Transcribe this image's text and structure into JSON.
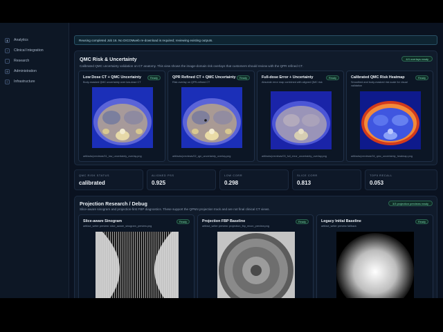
{
  "sidebar": {
    "items": [
      {
        "label": "Analytics",
        "icon": "chart-icon"
      },
      {
        "label": "Clinical Integration",
        "icon": "hospital-icon"
      },
      {
        "label": "Research",
        "icon": "flask-icon"
      },
      {
        "label": "Administration",
        "icon": "gear-icon"
      },
      {
        "label": "Infrastructure",
        "icon": "server-icon"
      }
    ]
  },
  "notice": {
    "text": "Reusing completed Job 16. No DICOMweb re-download is required; reviewing existing outputs."
  },
  "qmc": {
    "title": "QMC Risk & Uncertainty",
    "subtitle": "Calibrated QMC uncertainty validation on CT anatomy. This view shows the image-domain risk overlays that customers should review with the QPR refined CT.",
    "badge": "4/4 overlays ready",
    "cards": [
      {
        "title": "Low Dose CT + QMC Uncertainty",
        "status": "Ready",
        "desc": "Body-masked QMC uncertainty over low-dose CT",
        "path": "artifacts/previews/01_low_uncertainty_overlay.png"
      },
      {
        "title": "QPR Refined CT + QMC Uncertainty",
        "status": "Ready",
        "desc": "Risk overlay on QPR-refined CT",
        "path": "artifacts/previews/02_qpr_uncertainty_overlay.png"
      },
      {
        "title": "Full-dose Error + Uncertainty",
        "status": "Ready",
        "desc": "Absolute error map combined with aligned QMC risk",
        "path": "artifacts/previews/03_full_error_uncertainty_overlay.png"
      },
      {
        "title": "Calibrated QMC Risk Heatmap",
        "status": "Ready",
        "desc": "Smoothed and body-masked risk scale for visual validation",
        "path": "artifacts/previews/04_qmc_uncertainty_heatmap.png"
      }
    ]
  },
  "metrics": [
    {
      "label": "QMC RISK STATUS",
      "value": "calibrated"
    },
    {
      "label": "ALIGNED PSS",
      "value": "0.925"
    },
    {
      "label": "LOW CORR",
      "value": "0.298"
    },
    {
      "label": "SLICE CORR",
      "value": "0.813"
    },
    {
      "label": "TOP5 RECALL",
      "value": "0.053"
    }
  ],
  "projection": {
    "title": "Projection Research / Debug",
    "subtitle": "Slice-aware sinogram and projection-first FBP diagnostics. These support the QPNN projection track and are not final clinical CT views.",
    "badge": "3/3 projection previews ready",
    "cards": [
      {
        "title": "Slice-aware Sinogram",
        "status": "Ready",
        "desc": "artifact_writer preview: slice_aware_sinogram_preview.png"
      },
      {
        "title": "Projection FBP Baseline",
        "status": "Ready",
        "desc": "artifact_writer preview: projection_fbp_recon_preview.png"
      },
      {
        "title": "Legacy Initial Baseline",
        "status": "Ready",
        "desc": "artifact_writer preview fallback"
      }
    ]
  }
}
